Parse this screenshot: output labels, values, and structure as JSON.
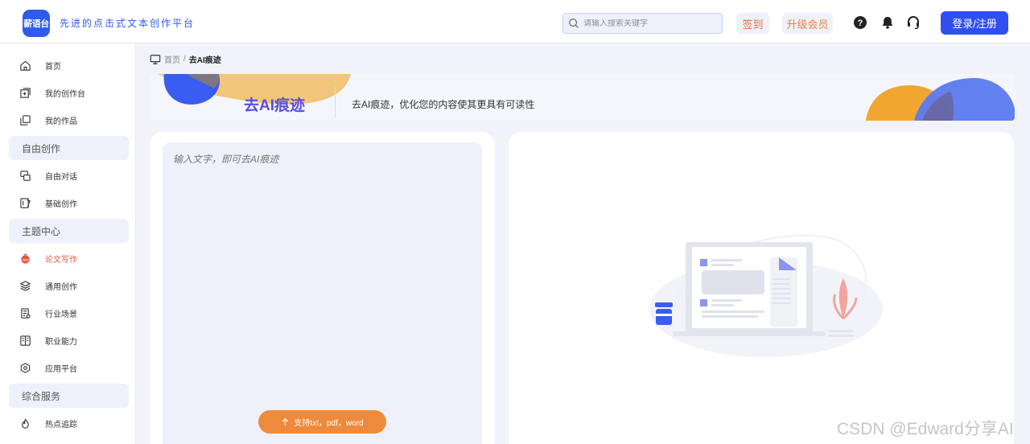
{
  "header": {
    "logo_text": "薪语台",
    "slogan": "先进的点击式文本创作平台",
    "search_placeholder": "请输入搜索关键字",
    "sign_in_label": "签到",
    "vip_label": "升级会员",
    "login_label": "登录/注册"
  },
  "sidebar": {
    "items_top": [
      {
        "label": "首页",
        "icon": "home-icon"
      },
      {
        "label": "我的创作台",
        "icon": "workspace-icon"
      },
      {
        "label": "我的作品",
        "icon": "works-icon"
      }
    ],
    "groups": [
      {
        "title": "自由创作",
        "items": [
          {
            "label": "自由对话",
            "icon": "chat-icon"
          },
          {
            "label": "基础创作",
            "icon": "basic-create-icon"
          }
        ]
      },
      {
        "title": "主题中心",
        "items": [
          {
            "label": "论文写作",
            "icon": "paper-icon",
            "active": true
          },
          {
            "label": "通用创作",
            "icon": "layers-icon"
          },
          {
            "label": "行业场景",
            "icon": "industry-icon"
          },
          {
            "label": "职业能力",
            "icon": "career-icon"
          },
          {
            "label": "应用平台",
            "icon": "platform-icon"
          }
        ]
      },
      {
        "title": "综合服务",
        "items": [
          {
            "label": "热点追踪",
            "icon": "hotspot-icon"
          }
        ]
      }
    ]
  },
  "breadcrumb": {
    "home": "首页",
    "separator": "/",
    "current": "去AI痕迹"
  },
  "banner": {
    "title": "去AI痕迹",
    "description": "去AI痕迹，优化您的内容使其更具有可读性"
  },
  "editor": {
    "placeholder": "输入文字，即可去AI痕迹",
    "upload_label": "支持txt，pdf，word"
  },
  "watermark": "CSDN @Edward分享AI",
  "colors": {
    "primary": "#2f4ff0",
    "accent_orange": "#ef8a3c",
    "active_red": "#e9553f",
    "background": "#f1f2fa"
  }
}
